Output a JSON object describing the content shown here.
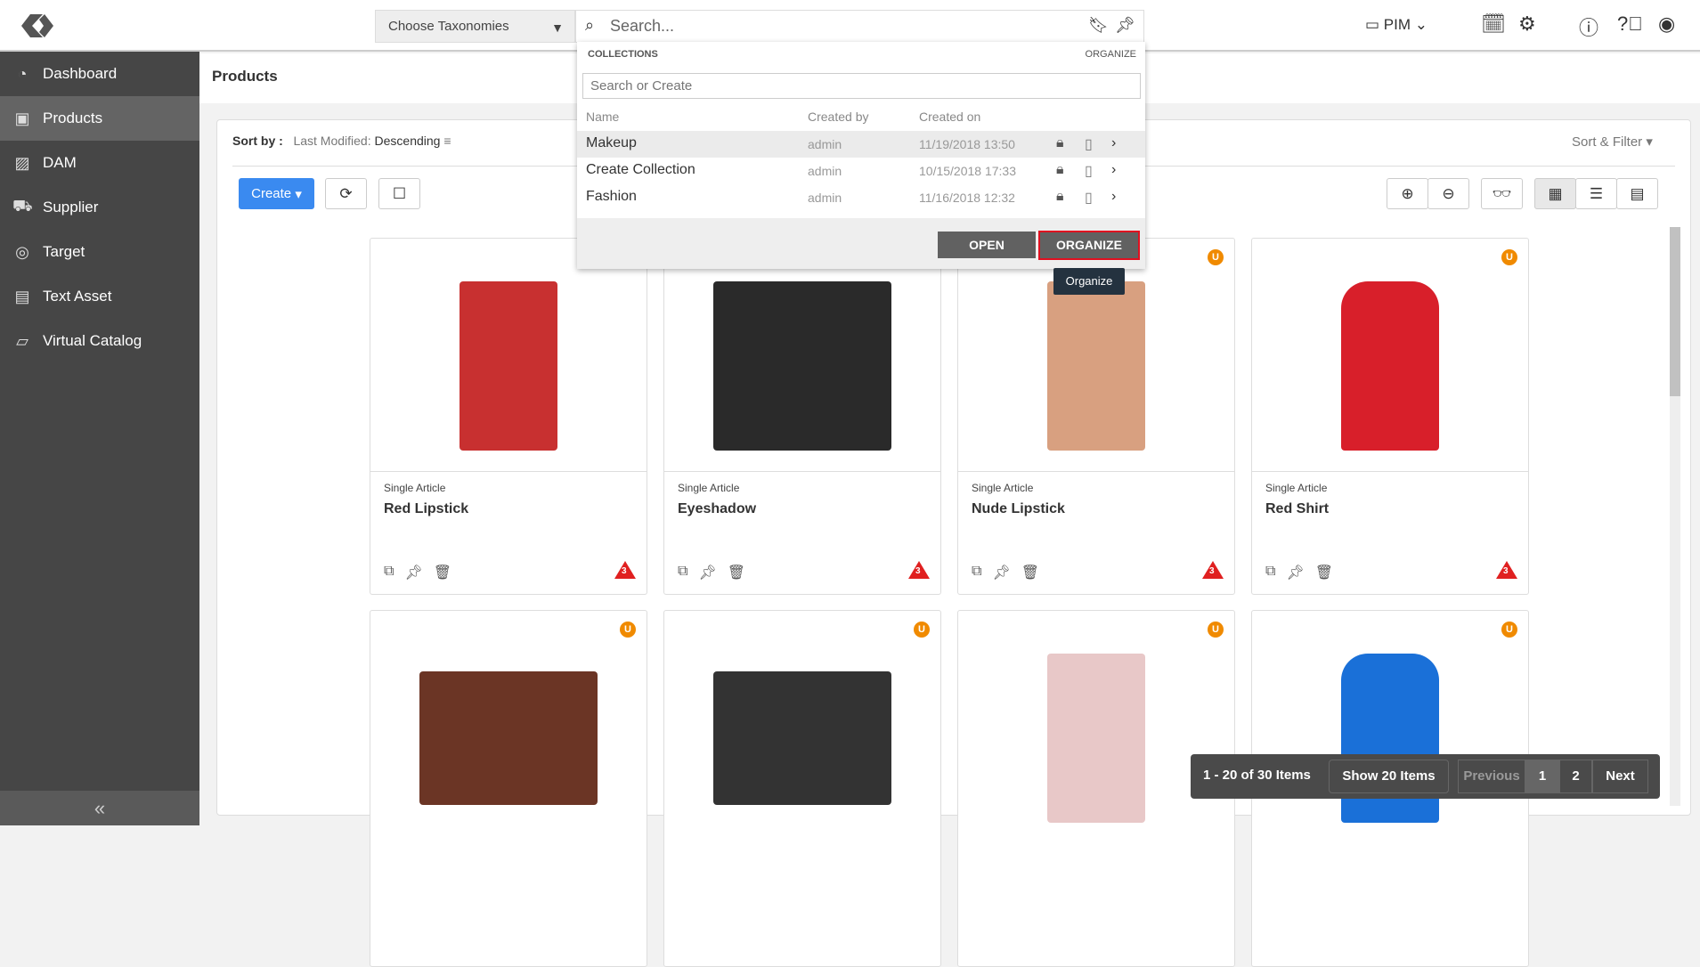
{
  "topbar": {
    "taxonomies": "Choose Taxonomies",
    "search_placeholder": "Search...",
    "module": "PIM"
  },
  "sidebar": {
    "items": [
      {
        "label": "Dashboard",
        "icon": "dashboard-icon"
      },
      {
        "label": "Products",
        "icon": "products-icon"
      },
      {
        "label": "DAM",
        "icon": "image-icon"
      },
      {
        "label": "Supplier",
        "icon": "truck-icon"
      },
      {
        "label": "Target",
        "icon": "target-icon"
      },
      {
        "label": "Text Asset",
        "icon": "document-icon"
      },
      {
        "label": "Virtual Catalog",
        "icon": "catalog-icon"
      }
    ],
    "collapse": "«"
  },
  "page": {
    "title": "Products",
    "sort_label": "Sort by :",
    "sort_field": "Last Modified:",
    "sort_order": "Descending",
    "sort_filter": "Sort & Filter",
    "create": "Create"
  },
  "collections": {
    "title": "COLLECTIONS",
    "organize_link": "ORGANIZE",
    "search_placeholder": "Search or Create",
    "columns": [
      "Name",
      "Created by",
      "Created on"
    ],
    "rows": [
      {
        "name": "Makeup",
        "by": "admin",
        "on": "11/19/2018 13:50"
      },
      {
        "name": "Create Collection",
        "by": "admin",
        "on": "10/15/2018 17:33"
      },
      {
        "name": "Fashion",
        "by": "admin",
        "on": "11/16/2018 12:32"
      }
    ],
    "open": "OPEN",
    "organize": "ORGANIZE",
    "tooltip": "Organize"
  },
  "products": [
    {
      "type": "Single Article",
      "name": "Red Lipstick",
      "warnings": "3",
      "badge": "",
      "color": "#c83030"
    },
    {
      "type": "Single Article",
      "name": "Eyeshadow",
      "warnings": "3",
      "badge": "",
      "color": "#2a2a2a"
    },
    {
      "type": "Single Article",
      "name": "Nude Lipstick",
      "warnings": "3",
      "badge": "U",
      "color": "#d8a080"
    },
    {
      "type": "Single Article",
      "name": "Red Shirt",
      "warnings": "3",
      "badge": "U",
      "color": "#d81f2a"
    },
    {
      "badge": "U",
      "color": "#6b3525"
    },
    {
      "badge": "U",
      "color": "#333333"
    },
    {
      "badge": "U",
      "color": "#e8c8c8"
    },
    {
      "badge": "U",
      "color": "#1a70d8"
    }
  ],
  "pagination": {
    "range": "1 - 20 of 30 Items",
    "show": "Show 20 Items",
    "prev": "Previous",
    "pages": [
      "1",
      "2"
    ],
    "next": "Next"
  }
}
